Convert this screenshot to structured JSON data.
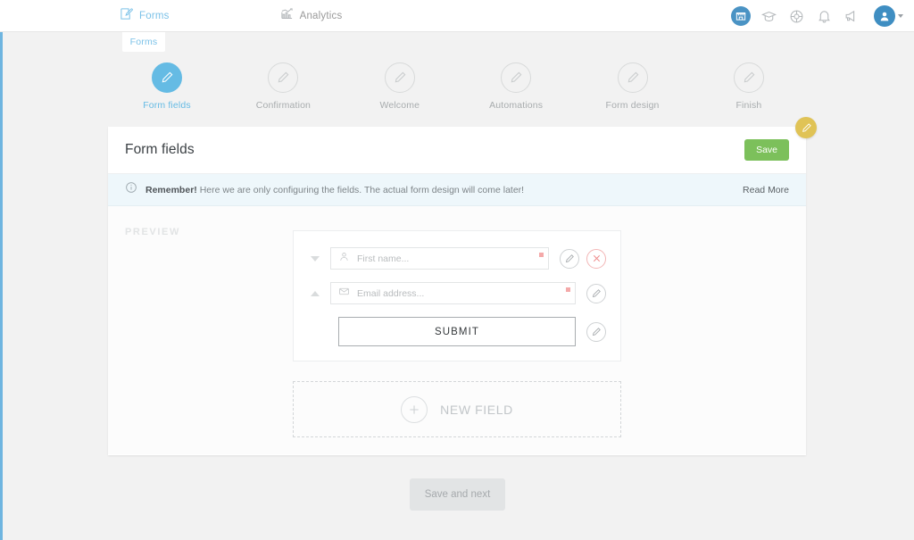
{
  "topnav": {
    "items": [
      {
        "label": "Forms",
        "icon": "form-edit-icon",
        "active": true
      },
      {
        "label": "Analytics",
        "icon": "analytics-chart-icon",
        "active": false
      }
    ],
    "actions": [
      {
        "name": "store-icon",
        "title": "Store"
      },
      {
        "name": "graduation-cap-icon",
        "title": "Academy"
      },
      {
        "name": "life-ring-icon",
        "title": "Support"
      },
      {
        "name": "bell-icon",
        "title": "Notifications"
      },
      {
        "name": "megaphone-icon",
        "title": "Announcements"
      }
    ],
    "avatar_label": "Account"
  },
  "subtab": {
    "label": "Forms"
  },
  "stepper": {
    "steps": [
      {
        "label": "Form fields",
        "active": true
      },
      {
        "label": "Confirmation",
        "active": false
      },
      {
        "label": "Welcome",
        "active": false
      },
      {
        "label": "Automations",
        "active": false
      },
      {
        "label": "Form design",
        "active": false
      },
      {
        "label": "Finish",
        "active": false
      }
    ]
  },
  "card": {
    "title": "Form fields",
    "save_label": "Save",
    "edit_badge_icon": "pencil-icon"
  },
  "notice": {
    "strong": "Remember!",
    "text": " Here we are only configuring the fields. The actual form design will come later!",
    "link_label": "Read More"
  },
  "preview": {
    "label": "PREVIEW",
    "fields": [
      {
        "placeholder": "First name...",
        "icon": "user-icon",
        "required": true,
        "reorder": "down",
        "has_delete": true
      },
      {
        "placeholder": "Email address...",
        "icon": "envelope-icon",
        "required": true,
        "reorder": "up",
        "has_delete": false
      }
    ],
    "submit_label": "SUBMIT",
    "new_field_label": "NEW FIELD"
  },
  "footer": {
    "save_next_label": "Save and next"
  },
  "colors": {
    "accent_blue": "#65bbe4",
    "save_green": "#7cc05b",
    "badge_yellow": "#e0c356",
    "required_red": "#f4a9a9",
    "page_bg": "#f2f2f2",
    "notice_bg": "#eef7fb"
  }
}
